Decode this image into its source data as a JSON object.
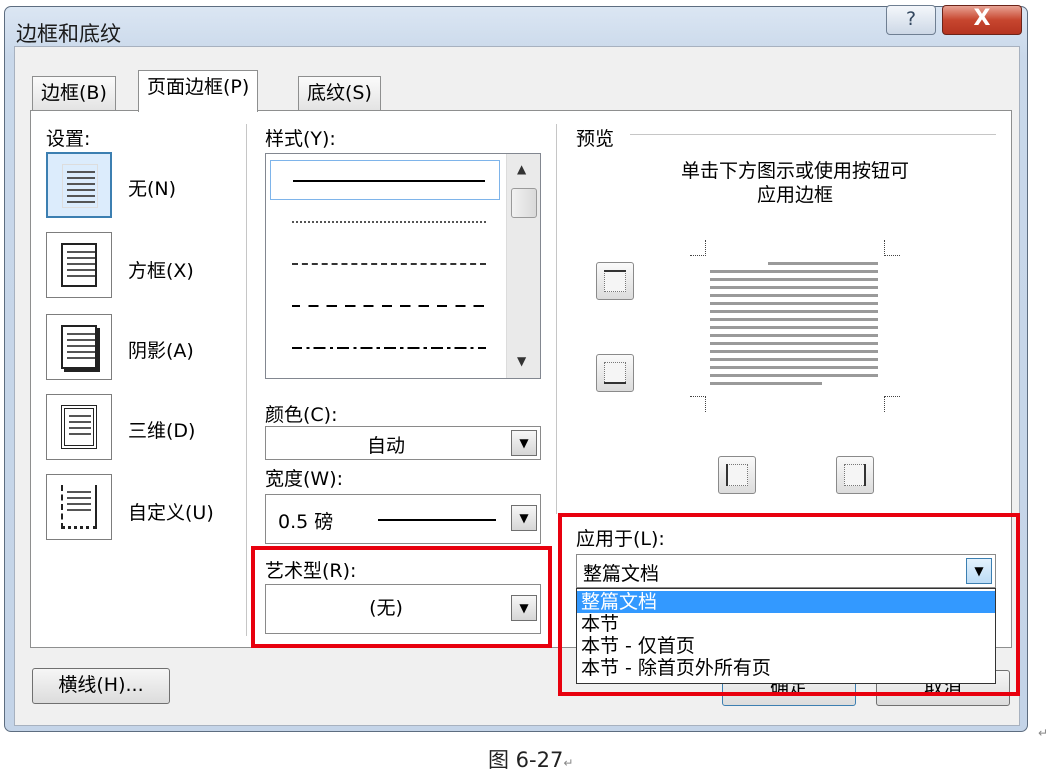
{
  "window": {
    "title": "边框和底纹",
    "help_glyph": "?",
    "close_glyph": "X"
  },
  "tabs": [
    {
      "label": "边框(B)"
    },
    {
      "label": "页面边框(P)",
      "active": true
    },
    {
      "label": "底纹(S)"
    }
  ],
  "settings": {
    "label": "设置:",
    "items": [
      {
        "label": "无(N)"
      },
      {
        "label": "方框(X)"
      },
      {
        "label": "阴影(A)"
      },
      {
        "label": "三维(D)"
      },
      {
        "label": "自定义(U)"
      }
    ]
  },
  "style": {
    "label": "样式(Y):"
  },
  "color": {
    "label": "颜色(C):",
    "value": "自动"
  },
  "width": {
    "label": "宽度(W):",
    "value": "0.5 磅"
  },
  "art": {
    "label": "艺术型(R):",
    "value": "(无)"
  },
  "preview": {
    "label": "预览",
    "hint_line1": "单击下方图示或使用按钮可",
    "hint_line2": "应用边框"
  },
  "apply_to": {
    "label": "应用于(L):",
    "value": "整篇文档",
    "options": [
      "整篇文档",
      "本节",
      "本节 - 仅首页",
      "本节 - 除首页外所有页"
    ]
  },
  "buttons": {
    "horizontal_line": "横线(H)...",
    "ok": "确定",
    "cancel": "取消"
  },
  "caption": "图 6-27",
  "colors": {
    "selection": "#3399ff",
    "highlight_box": "#e8000e"
  }
}
